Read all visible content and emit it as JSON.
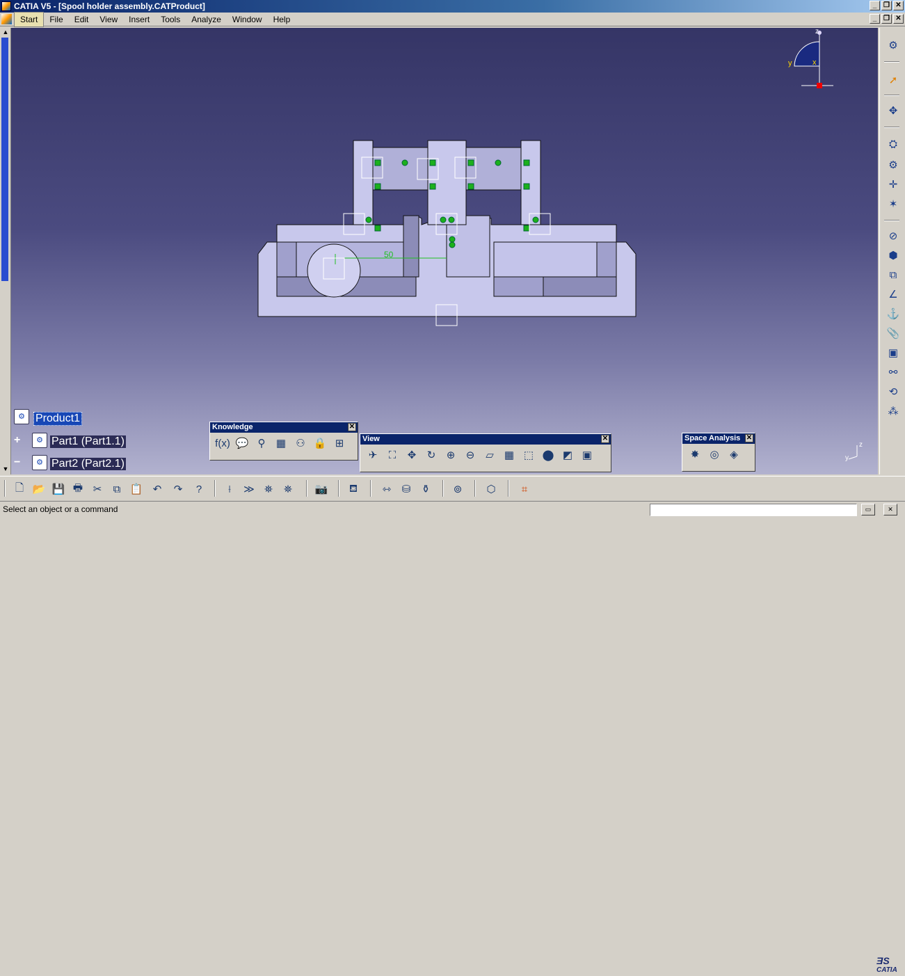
{
  "window": {
    "title": "CATIA V5 - [Spool holder assembly.CATProduct]",
    "minimize": "_",
    "restore": "❐",
    "close": "✕"
  },
  "menu": [
    {
      "label": "Start",
      "active": true
    },
    {
      "label": "File"
    },
    {
      "label": "Edit"
    },
    {
      "label": "View"
    },
    {
      "label": "Insert"
    },
    {
      "label": "Tools"
    },
    {
      "label": "Analyze"
    },
    {
      "label": "Window"
    },
    {
      "label": "Help"
    }
  ],
  "tree": {
    "root": "Product1",
    "children": [
      {
        "label": "Part1 (Part1.1)",
        "expander": "+"
      },
      {
        "label": "Part2 (Part2.1)",
        "expander": "−"
      }
    ]
  },
  "compass": {
    "z": "z",
    "y": "y",
    "x": "x"
  },
  "axes_mini": {
    "z": "z",
    "y": "y"
  },
  "dimension": {
    "value": "50"
  },
  "toolbars": {
    "knowledge": {
      "title": "Knowledge",
      "icons": [
        "formula-icon",
        "comment-icon",
        "lightbulb-icon",
        "design-table-icon",
        "knowledge-tree-icon",
        "lock-icon",
        "parameters-icon"
      ],
      "glyphs": [
        "f(x)",
        "💬",
        "⚲",
        "▦",
        "⚇",
        "🔒",
        "⊞"
      ]
    },
    "view": {
      "title": "View",
      "icons": [
        "fly-mode-icon",
        "fit-all-icon",
        "pan-icon",
        "rotate-icon",
        "zoom-in-icon",
        "zoom-out-icon",
        "normal-view-icon",
        "multi-view-icon",
        "iso-view-icon",
        "shading-icon",
        "hide-show-icon",
        "swap-space-icon"
      ],
      "glyphs": [
        "✈",
        "⛶",
        "✥",
        "↻",
        "⊕",
        "⊖",
        "⏥",
        "▦",
        "⬚",
        "⬤",
        "◩",
        "▣"
      ]
    },
    "space_analysis": {
      "title": "Space Analysis",
      "icons": [
        "clash-icon",
        "sectioning-icon",
        "distance-icon"
      ],
      "glyphs": [
        "✸",
        "◎",
        "◈"
      ]
    }
  },
  "status": {
    "message": "Select an object or a command"
  },
  "branding": {
    "logo": "CATIA"
  }
}
